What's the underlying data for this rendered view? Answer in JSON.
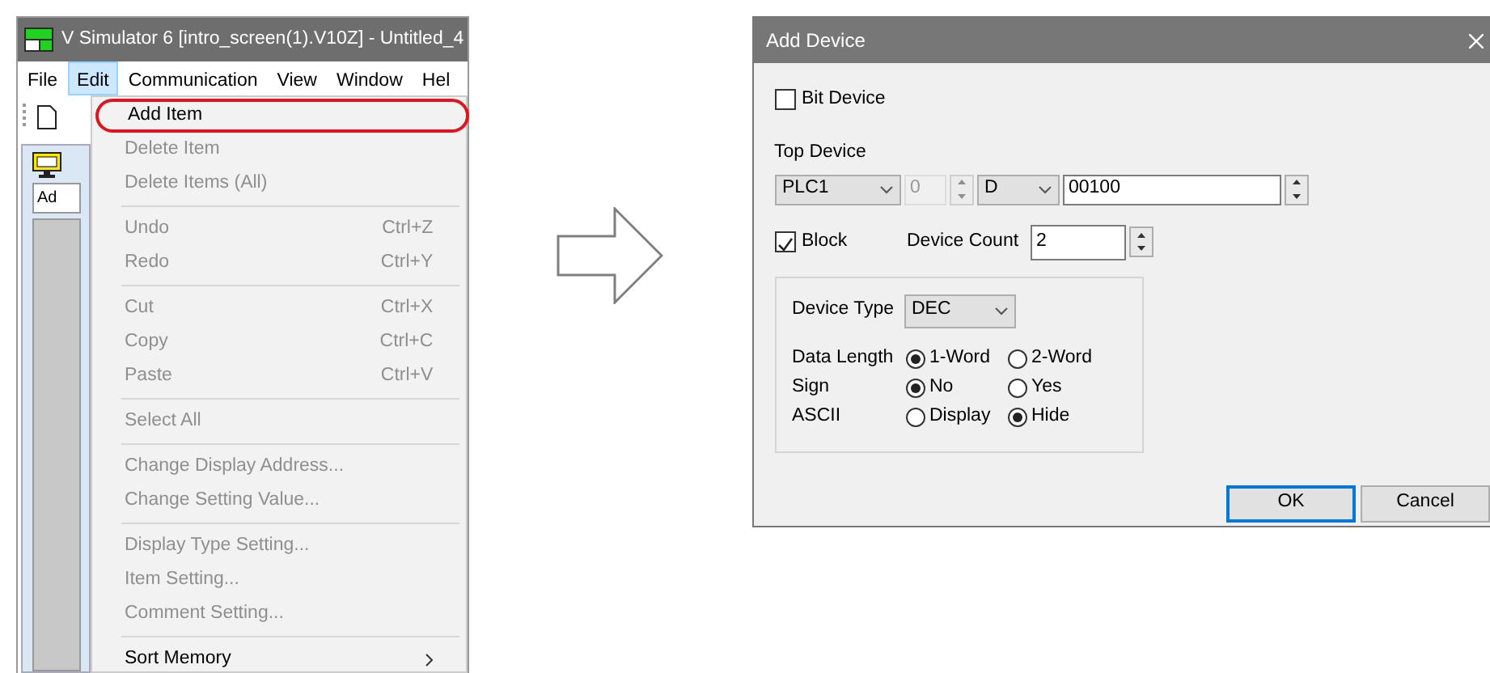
{
  "app_window": {
    "title": "V Simulator 6 [intro_screen(1).V10Z] - Untitled_4",
    "menu_bar": [
      {
        "label": "File",
        "selected": false
      },
      {
        "label": "Edit",
        "selected": true
      },
      {
        "label": "Communication",
        "selected": false
      },
      {
        "label": "View",
        "selected": false
      },
      {
        "label": "Window",
        "selected": false
      },
      {
        "label": "Hel",
        "selected": false
      }
    ],
    "child_tab_text": "Ad",
    "edit_menu": [
      {
        "kind": "item",
        "label": "Add Item",
        "disabled": false,
        "highlighted": true
      },
      {
        "kind": "item",
        "label": "Delete Item",
        "disabled": true,
        "highlighted": false
      },
      {
        "kind": "item",
        "label": "Delete Items (All)",
        "disabled": true,
        "highlighted": false
      },
      {
        "kind": "separator"
      },
      {
        "kind": "item",
        "label": "Undo",
        "shortcut": "Ctrl+Z",
        "disabled": true,
        "highlighted": false
      },
      {
        "kind": "item",
        "label": "Redo",
        "shortcut": "Ctrl+Y",
        "disabled": true,
        "highlighted": false
      },
      {
        "kind": "separator"
      },
      {
        "kind": "item",
        "label": "Cut",
        "shortcut": "Ctrl+X",
        "disabled": true,
        "highlighted": false
      },
      {
        "kind": "item",
        "label": "Copy",
        "shortcut": "Ctrl+C",
        "disabled": true,
        "highlighted": false
      },
      {
        "kind": "item",
        "label": "Paste",
        "shortcut": "Ctrl+V",
        "disabled": true,
        "highlighted": false
      },
      {
        "kind": "separator"
      },
      {
        "kind": "item",
        "label": "Select All",
        "disabled": true,
        "highlighted": false
      },
      {
        "kind": "separator"
      },
      {
        "kind": "item",
        "label": "Change Display Address...",
        "disabled": true,
        "highlighted": false
      },
      {
        "kind": "item",
        "label": "Change Setting Value...",
        "disabled": true,
        "highlighted": false
      },
      {
        "kind": "separator"
      },
      {
        "kind": "item",
        "label": "Display Type Setting...",
        "disabled": true,
        "highlighted": false
      },
      {
        "kind": "item",
        "label": "Item Setting...",
        "disabled": true,
        "highlighted": false
      },
      {
        "kind": "item",
        "label": "Comment Setting...",
        "disabled": true,
        "highlighted": false
      },
      {
        "kind": "separator"
      },
      {
        "kind": "submenu",
        "label": "Sort Memory",
        "disabled": false,
        "highlighted": false
      }
    ]
  },
  "dialog": {
    "title": "Add Device",
    "bit_device": {
      "label": "Bit Device",
      "checked": false
    },
    "top_device": {
      "label": "Top Device",
      "plc": "PLC1",
      "port": "0",
      "port_disabled": true,
      "device": "D",
      "address": "00100"
    },
    "block": {
      "label": "Block",
      "checked": true
    },
    "device_count": {
      "label": "Device Count",
      "value": "2"
    },
    "device_type": {
      "label": "Device Type",
      "value": "DEC"
    },
    "radio_rows": [
      {
        "label": "Data Length",
        "options": [
          {
            "label": "1-Word",
            "selected": true
          },
          {
            "label": "2-Word",
            "selected": false
          }
        ]
      },
      {
        "label": "Sign",
        "options": [
          {
            "label": "No",
            "selected": true
          },
          {
            "label": "Yes",
            "selected": false
          }
        ]
      },
      {
        "label": "ASCII",
        "options": [
          {
            "label": "Display",
            "selected": false
          },
          {
            "label": "Hide",
            "selected": true
          }
        ]
      }
    ],
    "buttons": [
      {
        "label": "OK",
        "default": true
      },
      {
        "label": "Cancel",
        "default": false
      }
    ]
  }
}
